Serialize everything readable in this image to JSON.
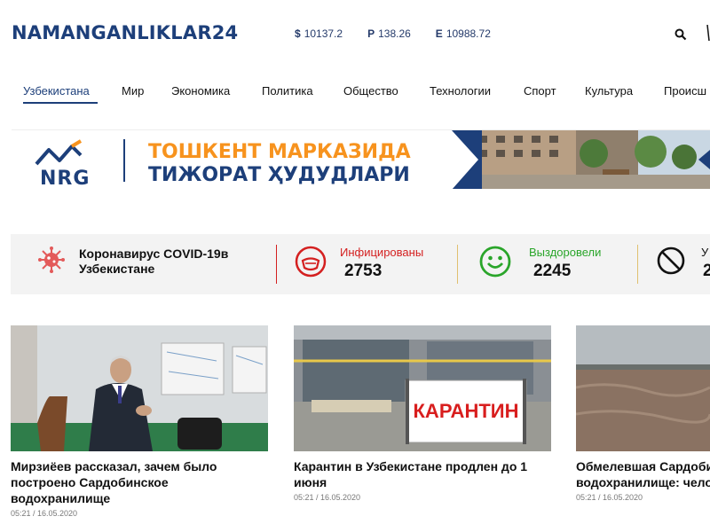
{
  "site": {
    "logo": "NAMANGANLIKLAR24"
  },
  "rates": [
    {
      "symbol": "$",
      "value": "10137.2"
    },
    {
      "symbol": "P",
      "value": "138.26"
    },
    {
      "symbol": "E",
      "value": "10988.72"
    }
  ],
  "nav": [
    {
      "label": "Узбекистана"
    },
    {
      "label": "Мир"
    },
    {
      "label": "Экономика"
    },
    {
      "label": "Политика"
    },
    {
      "label": "Общество"
    },
    {
      "label": "Технологии"
    },
    {
      "label": "Спорт"
    },
    {
      "label": "Культура"
    },
    {
      "label": "Происш"
    }
  ],
  "banner": {
    "brand": "NRG",
    "line1": "ТОШКЕНТ МАРКАЗИДА",
    "line2": "ТИЖОРАТ ҲУДУДЛАРИ"
  },
  "covid": {
    "title": "Коронавирус COVID-19в Узбекистане",
    "stats": [
      {
        "label": "Инфицированы",
        "value": "2753",
        "color": "#d42020"
      },
      {
        "label": "Выздоровели",
        "value": "2245",
        "color": "#2aa52a"
      },
      {
        "label": "У",
        "value": "2",
        "color": "#111111"
      }
    ]
  },
  "news": [
    {
      "title": "Мирзиёев рассказал, зачем было построено Сардобинское водохранилище",
      "date": "05:21 / 16.05.2020"
    },
    {
      "title": "Карантин в Узбекистане продлен до 1 июня",
      "date": "05:21 / 16.05.2020",
      "image_text": "КАРАНТИН"
    },
    {
      "title": "Обмелевшая Сардобинское водохранилище: человеческий фактор",
      "date": "05:21 / 16.05.2020"
    }
  ],
  "colors": {
    "brand": "#1d3f7a",
    "accent": "#f7931e",
    "danger": "#d42020",
    "success": "#2aa52a"
  }
}
